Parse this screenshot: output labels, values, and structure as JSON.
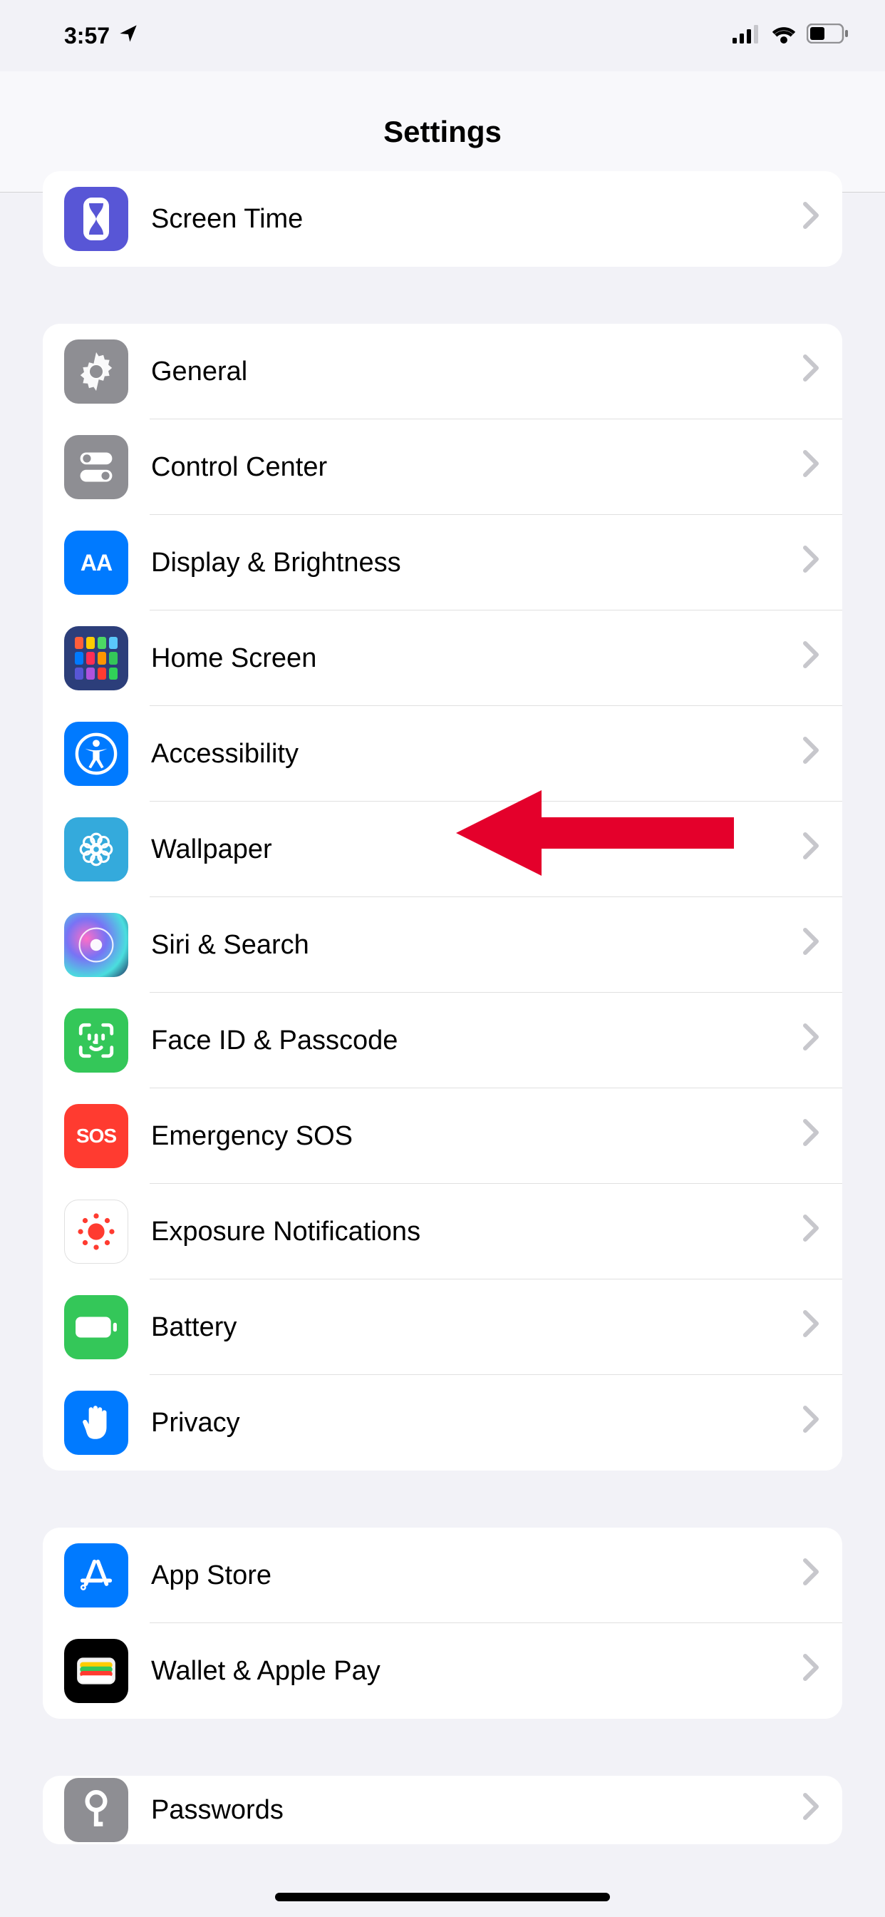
{
  "status": {
    "time": "3:57"
  },
  "nav": {
    "title": "Settings"
  },
  "groups": [
    {
      "id": "g0",
      "partial_top": true,
      "rows": [
        {
          "id": "screen-time",
          "label": "Screen Time",
          "icon": "hourglass",
          "bg": "bg-purple"
        }
      ]
    },
    {
      "id": "g1",
      "rows": [
        {
          "id": "general",
          "label": "General",
          "icon": "gear",
          "bg": "bg-gray"
        },
        {
          "id": "control-center",
          "label": "Control Center",
          "icon": "switches",
          "bg": "bg-gray"
        },
        {
          "id": "display-brightness",
          "label": "Display & Brightness",
          "icon": "aa",
          "bg": "bg-blue"
        },
        {
          "id": "home-screen",
          "label": "Home Screen",
          "icon": "app-grid",
          "bg": "bg-darkblue"
        },
        {
          "id": "accessibility",
          "label": "Accessibility",
          "icon": "accessibility",
          "bg": "bg-blue"
        },
        {
          "id": "wallpaper",
          "label": "Wallpaper",
          "icon": "flower",
          "bg": "bg-cyan"
        },
        {
          "id": "siri-search",
          "label": "Siri & Search",
          "icon": "siri",
          "bg": "bg-siri"
        },
        {
          "id": "faceid-passcode",
          "label": "Face ID & Passcode",
          "icon": "faceid",
          "bg": "bg-green"
        },
        {
          "id": "emergency-sos",
          "label": "Emergency SOS",
          "icon": "sos",
          "bg": "bg-red"
        },
        {
          "id": "exposure-notifications",
          "label": "Exposure Notifications",
          "icon": "exposure",
          "bg": "bg-white"
        },
        {
          "id": "battery",
          "label": "Battery",
          "icon": "battery",
          "bg": "bg-green"
        },
        {
          "id": "privacy",
          "label": "Privacy",
          "icon": "hand",
          "bg": "bg-blue"
        }
      ]
    },
    {
      "id": "g2",
      "rows": [
        {
          "id": "app-store",
          "label": "App Store",
          "icon": "appstore",
          "bg": "bg-blue"
        },
        {
          "id": "wallet-apple-pay",
          "label": "Wallet & Apple Pay",
          "icon": "wallet",
          "bg": "bg-black"
        }
      ]
    },
    {
      "id": "g3",
      "partial_bottom": true,
      "rows": [
        {
          "id": "passwords",
          "label": "Passwords",
          "icon": "key",
          "bg": "bg-gray"
        }
      ]
    }
  ],
  "annotation": {
    "target": "accessibility"
  }
}
